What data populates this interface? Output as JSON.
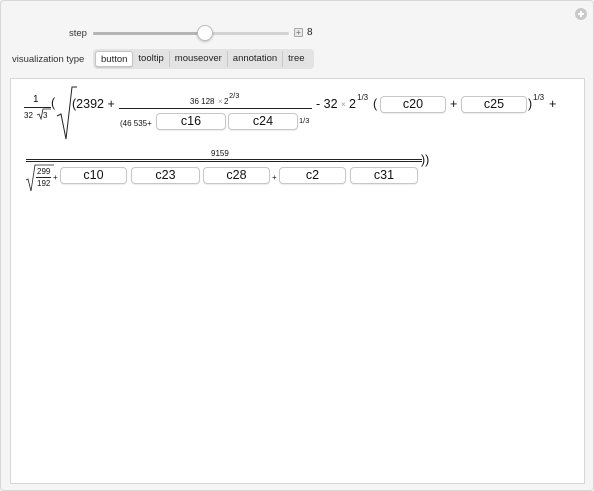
{
  "controls": {
    "step_label": "step",
    "step_value": "8",
    "step_fraction": 0.57,
    "visualization_label": "visualization type",
    "tabs": [
      {
        "label": "button",
        "active": true
      },
      {
        "label": "tooltip",
        "active": false
      },
      {
        "label": "mouseover",
        "active": false
      },
      {
        "label": "annotation",
        "active": false
      },
      {
        "label": "tree",
        "active": false
      }
    ]
  },
  "expr": {
    "frac_num": "1",
    "frac_den_32": "32",
    "frac_den_sqrt3": "3",
    "open_paren": "(",
    "t_2392": "(2392 +",
    "n36128": "36 128",
    "times": "×",
    "two": "2",
    "exp_2_3": "2/3",
    "den_46535": "(46 535+",
    "exp_1_3_a": "1/3",
    "minus32": "- 32",
    "times2": "×",
    "two2": "2",
    "exp_1_3_b": "1/3",
    "paren2": "(",
    "plus_a": "+",
    "close_exp": ")",
    "exp_1_3_c": "1/3",
    "plus_end": "+",
    "n9159": "9159",
    "r299": "299",
    "r192": "192",
    "plus_b": "+",
    "plus_c": "+",
    "close_end": "))",
    "buttons": {
      "c16": "c16",
      "c24": "c24",
      "c20": "c20",
      "c25": "c25",
      "c10": "c10",
      "c23": "c23",
      "c28": "c28",
      "c2": "c2",
      "c31": "c31"
    }
  }
}
